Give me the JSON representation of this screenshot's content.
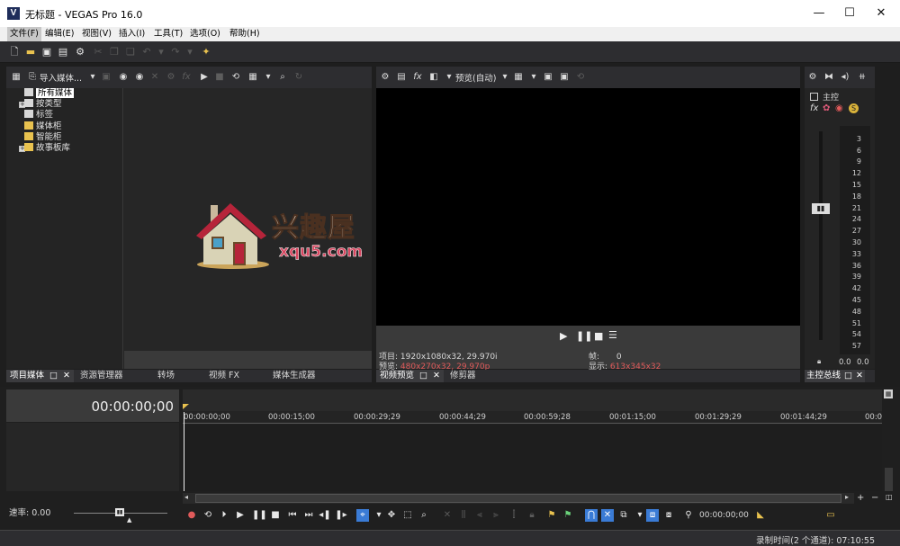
{
  "window": {
    "title": "无标题 - VEGAS Pro 16.0",
    "app_icon": "V",
    "minimize": "—",
    "maximize": "☐",
    "close": "✕"
  },
  "menu": [
    "文件(F)",
    "编辑(E)",
    "视图(V)",
    "插入(I)",
    "工具(T)",
    "选项(O)",
    "帮助(H)"
  ],
  "media_panel": {
    "import_label": "导入媒体...",
    "tree": [
      "所有媒体",
      "按类型",
      "标签",
      "媒体柜",
      "智能柜",
      "故事板库"
    ],
    "tabs": [
      "项目媒体",
      "资源管理器",
      "转场",
      "视频 FX",
      "媒体生成器"
    ]
  },
  "watermark": {
    "cn": "兴趣屋",
    "url": "xqu5.com"
  },
  "preview": {
    "quality_label": "预览(自动)",
    "project_label": "项目:",
    "project_value": "1920x1080x32, 29.970i",
    "preview_label": "预览:",
    "preview_value": "480x270x32, 29.970p",
    "frame_label": "帧:",
    "frame_value": "0",
    "display_label": "显示:",
    "display_value": "613x345x32",
    "tabs": [
      "视频预览",
      "修剪器"
    ]
  },
  "mixer": {
    "master_label": "主控",
    "db_marks": [
      "3",
      "6",
      "9",
      "12",
      "15",
      "18",
      "21",
      "24",
      "27",
      "30",
      "33",
      "36",
      "39",
      "42",
      "45",
      "48",
      "51",
      "54",
      "57"
    ],
    "left_value": "0.0",
    "right_value": "0.0",
    "tab": "主控总线"
  },
  "timeline": {
    "timecode": "00:00:00;00",
    "ruler": [
      "00:00:00;00",
      "00:00:15;00",
      "00:00:29;29",
      "00:00:44;29",
      "00:00:59;28",
      "00:01:15;00",
      "00:01:29;29",
      "00:01:44;29",
      "00:0"
    ],
    "rate_label": "速率: 0.00",
    "cursor_time": "00:00:00;00"
  },
  "status": {
    "record_time": "录制时间(2 个通道): 07:10:55"
  },
  "colors": {
    "accent_blue": "#3a7bd5",
    "info_red": "#e05a5a",
    "folder_yellow": "#e9c24f"
  }
}
